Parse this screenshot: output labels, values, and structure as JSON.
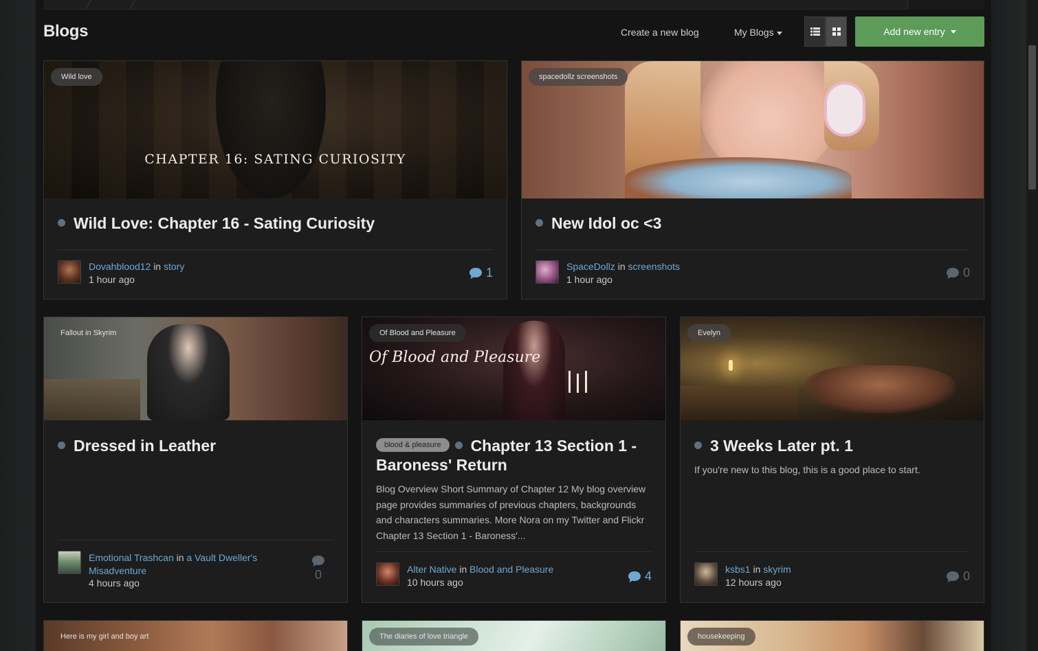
{
  "header": {
    "title": "Blogs",
    "create_link": "Create a new blog",
    "my_blogs": "My Blogs",
    "add_entry": "Add new entry",
    "accent": "#5d9b58",
    "link_color": "#6fa9d3"
  },
  "cards": [
    {
      "tag": "Wild love",
      "cover_text": "CHAPTER 16: SATING CURIOSITY",
      "title": "Wild Love: Chapter 16 - Sating Curiosity",
      "author": "Dovahblood12",
      "in_text": "in",
      "category": "story",
      "time": "1 hour ago",
      "comments": "1"
    },
    {
      "tag": "spacedollz screenshots",
      "title": "New Idol oc <3",
      "author": "SpaceDollz",
      "in_text": "in",
      "category": "screenshots",
      "time": "1 hour ago",
      "comments": "0"
    },
    {
      "tag": "Fallout in Skyrim",
      "title": "Dressed in Leather",
      "author": "Emotional Trashcan",
      "in_text": "in",
      "category": "a Vault Dweller's Misadventure",
      "time": "4 hours ago",
      "comments": "0"
    },
    {
      "tag": "Of Blood and Pleasure",
      "cover_text": "Of Blood and Pleasure",
      "pill": "blood & pleasure",
      "title": "Chapter 13 Section 1 - Baroness' Return",
      "snippet": "Blog Overview      Short Summary of Chapter 12      My blog overview page provides summaries of previous chapters, backgrounds and characters summaries.      More Nora on my Twitter and Flickr      Chapter 13 Section 1 - Baroness'...",
      "author": "Alter Native",
      "in_text": "in",
      "category": "Blood and Pleasure",
      "time": "10 hours ago",
      "comments": "4"
    },
    {
      "tag": "Evelyn",
      "title": "3 Weeks Later pt. 1",
      "snippet": "If you're new to this blog, this is a good place to start.",
      "author": "ksbs1",
      "in_text": "in",
      "category": "skyrim",
      "time": "12 hours ago",
      "comments": "0"
    },
    {
      "tag": "Here is my girl and boy art"
    },
    {
      "tag": "The diaries of love triangle"
    },
    {
      "tag": "housekeeping"
    }
  ]
}
